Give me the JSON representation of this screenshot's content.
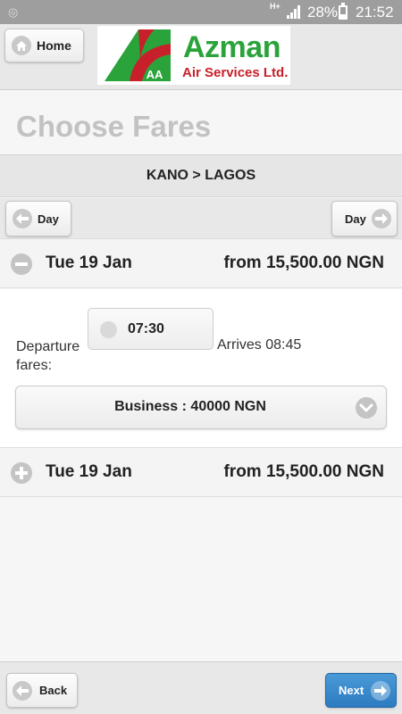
{
  "status_bar": {
    "network": "H+",
    "battery": "28%",
    "battery_level": 0.28,
    "time": "21:52"
  },
  "header": {
    "home_label": "Home",
    "logo": {
      "mark_text": "AA",
      "name": "Azman",
      "subtitle": "Air Services Ltd."
    }
  },
  "page_title": "Choose Fares",
  "route": "KANO > LAGOS",
  "day_nav": {
    "prev_label": "Day",
    "next_label": "Day"
  },
  "flights": [
    {
      "expanded": true,
      "date": "Tue 19 Jan",
      "price": "from 15,500.00 NGN",
      "departure_label": "Departure fares:",
      "departure_time": "07:30",
      "arrival": "Arrives 08:45",
      "selected_fare": "Business : 40000 NGN"
    },
    {
      "expanded": false,
      "date": "Tue 19 Jan",
      "price": "from 15,500.00 NGN"
    }
  ],
  "footer": {
    "back_label": "Back",
    "next_label": "Next"
  },
  "colors": {
    "brand_green": "#2aa33b",
    "brand_red": "#c8202a",
    "next_button": "#2d7bc0"
  }
}
